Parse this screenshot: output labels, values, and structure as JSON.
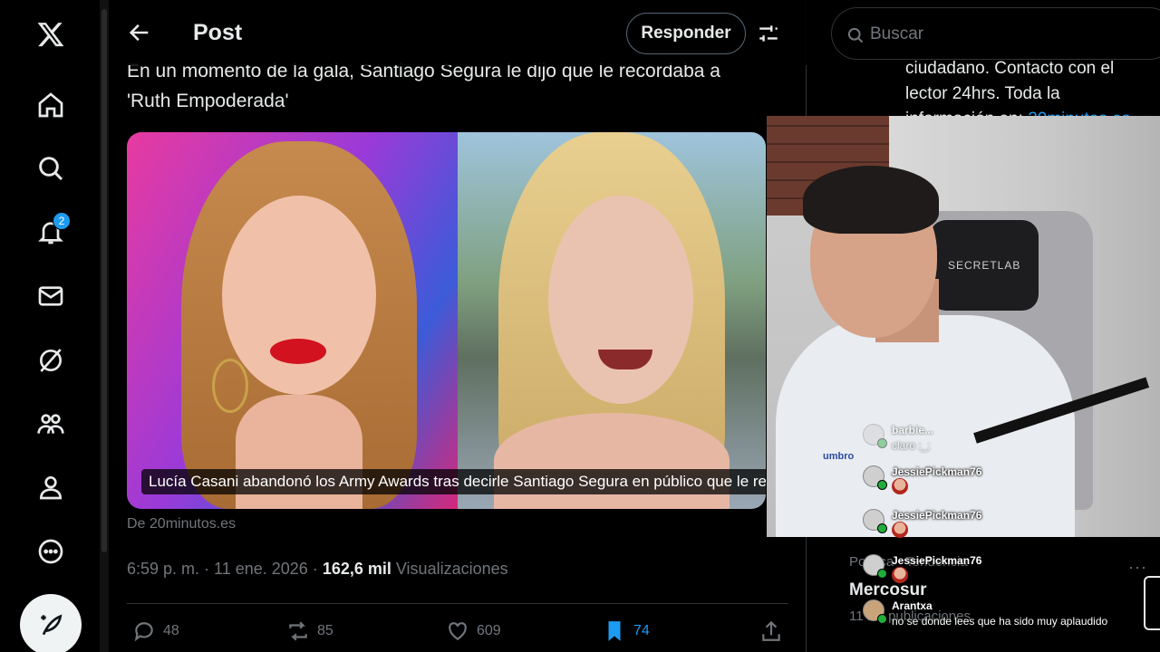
{
  "nav": {
    "notifications_badge": "2"
  },
  "header": {
    "title": "Post",
    "reply_label": "Responder"
  },
  "tweet": {
    "text": "En un momento de la gala, Santiago Segura le dijo que le recordaba a 'Ruth Empoderada'",
    "media_caption": "Lucía Casani abandonó los Army Awards tras decirle Santiago Segura en público que le re...",
    "source": "De 20minutos.es",
    "time": "6:59 p. m. · 11 ene. 2026 · ",
    "views_count": "162,6 mil",
    "views_label": " Visualizaciones",
    "replies": "48",
    "reposts": "85",
    "likes": "609",
    "bookmarks": "74",
    "bookmark_color": "#1d9bf0"
  },
  "right": {
    "search_placeholder": "Buscar",
    "bio_line1": "ciudadano. Contacto con el",
    "bio_line2": "lector 24hrs. Toda la",
    "bio_line3": "información en: ",
    "bio_link": "20minutos.es",
    "trend_category": "Política · Tendencia",
    "trend_name": "Mercosur",
    "trend_count": "11 mil publicaciones",
    "trend_more": "···"
  },
  "webcam": {
    "chair_brand": "SECRETLAB",
    "shirt_brand": "umbro"
  },
  "chat": [
    {
      "user": "barbie...",
      "text": "claro ;_;",
      "faded": true
    },
    {
      "user": "JessiePickman76",
      "text": "",
      "emote": true
    },
    {
      "user": "JessiePickman76",
      "text": "",
      "emote": true
    },
    {
      "user": "JessiePickman76",
      "text": "",
      "emote": true
    },
    {
      "user": "Arantxa",
      "text": "no se donde lees que ha sido muy aplaudido"
    }
  ]
}
